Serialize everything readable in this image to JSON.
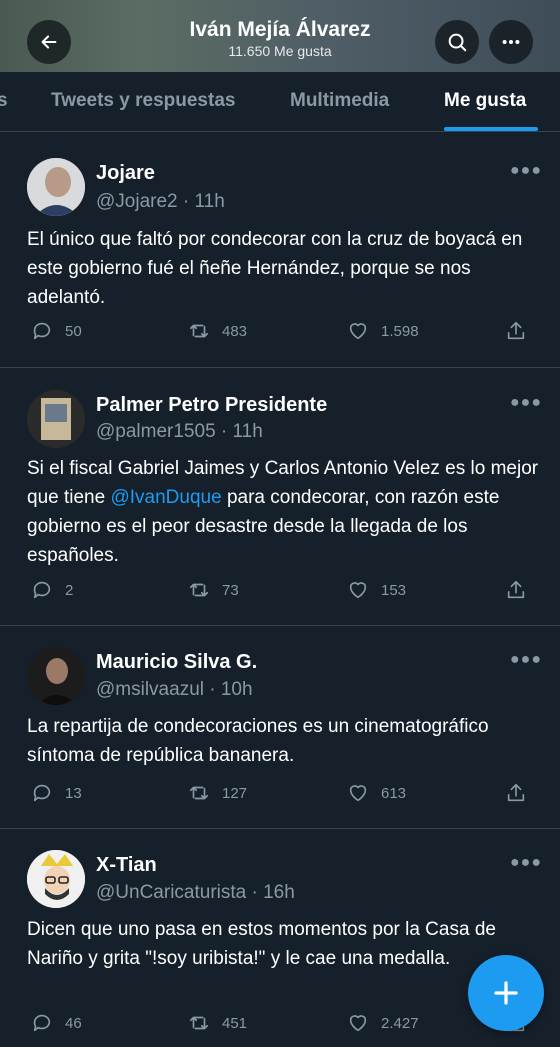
{
  "header": {
    "title": "Iván Mejía Álvarez",
    "subtitle": "11.650 Me gusta"
  },
  "tabs": [
    {
      "label": "s"
    },
    {
      "label": "Tweets y respuestas"
    },
    {
      "label": "Multimedia"
    },
    {
      "label": "Me gusta",
      "active": true
    }
  ],
  "tweets": [
    {
      "name": "Jojare",
      "handle": "@Jojare2 · 11h",
      "text": "El único que faltó por condecorar con la cruz de boyacá en este gobierno fué el ñeñe Hernández, porque se nos adelantó.",
      "replies": "50",
      "retweets": "483",
      "likes": "1.598"
    },
    {
      "name": "Palmer Petro Presidente",
      "handle": "@palmer1505 · 11h",
      "text_before": "Si el fiscal Gabriel Jaimes y Carlos Antonio Velez es lo mejor que tiene ",
      "mention": "@IvanDuque",
      "text_after": " para condecorar, con razón este gobierno es el peor desastre desde la llegada de los españoles.",
      "replies": "2",
      "retweets": "73",
      "likes": "153"
    },
    {
      "name": "Mauricio Silva G.",
      "handle": "@msilvaazul · 10h",
      "text": "La repartija de condecoraciones es un cinematográfico síntoma de república bananera.",
      "replies": "13",
      "retweets": "127",
      "likes": "613"
    },
    {
      "name": "X-Tian",
      "handle": "@UnCaricaturista · 16h",
      "text": "Dicen que uno pasa en estos momentos por la Casa de Nariño y grita \"!soy uribista!\" y le cae una medalla.",
      "replies": "46",
      "retweets": "451",
      "likes": "2.427"
    }
  ],
  "icons": {
    "back": "arrow-left-icon",
    "search": "search-icon",
    "more": "more-horizontal-icon",
    "reply": "reply-icon",
    "retweet": "retweet-icon",
    "like": "heart-icon",
    "share": "share-icon",
    "compose": "plus-icon"
  },
  "colors": {
    "background": "#15202b",
    "accent": "#1d9bf0",
    "muted": "#8b98a5",
    "divider": "#38444d"
  }
}
